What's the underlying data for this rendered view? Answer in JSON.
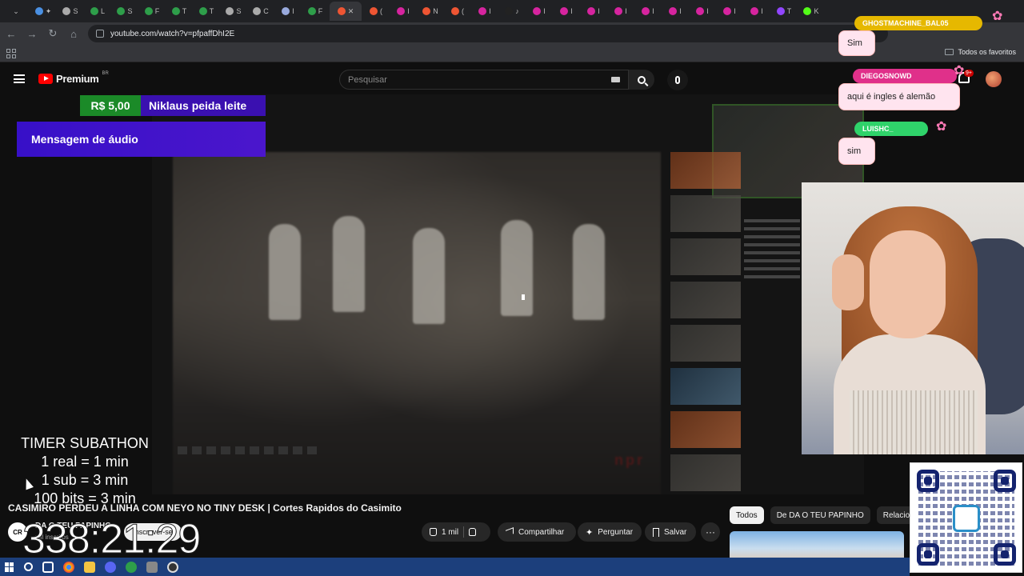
{
  "browser": {
    "url": "youtube.com/watch?v=pfpaffDhI2E",
    "all_favorites_label": "Todos os favoritos"
  },
  "header": {
    "logo_text": "Premium",
    "logo_region": "BR",
    "search_placeholder": "Pesquisar",
    "notification_badge": "9+"
  },
  "donation": {
    "amount": "R$ 5,00",
    "message": "Niklaus peida leite",
    "audio_label": "Mensagem de áudio"
  },
  "timer": {
    "title": "TIMER SUBATHON",
    "lines": [
      "1 real = 1 min",
      "1 sub = 3 min",
      "100 bits = 3 min"
    ],
    "value": "338:21:29"
  },
  "video": {
    "title": "CASIMIRO PERDEU A LINHA COM NEYO NO TINY DESK | Cortes Rapidos do Casimito",
    "channel_initials": "CR",
    "channel_name": "DA O TEU PAPINHO",
    "channel_subs": "mil inscritos",
    "subscribe_label": "Inscrever-se",
    "likes": "1 mil",
    "share_label": "Compartilhar",
    "ask_label": "Perguntar",
    "save_label": "Salvar",
    "more_label": "···"
  },
  "related": {
    "chips": [
      "Todos",
      "De DA O TEU PAPINHO",
      "Relacionad"
    ]
  },
  "chat": {
    "messages": [
      {
        "user": "GHOSTMACHINE_BAL05",
        "text": "Sim",
        "color": "#e6b800"
      },
      {
        "user": "DIEGOSNOWD",
        "text": "aqui é ingles é alemão",
        "color": "#e0308a"
      },
      {
        "user": "LUISHC_",
        "text": "sim",
        "color": "#2fd36a"
      }
    ]
  },
  "colors": {
    "donation_amount_bg": "#1b8a28",
    "donation_msg_bg": "#3a10b0",
    "youtube_red": "#ff0000"
  }
}
